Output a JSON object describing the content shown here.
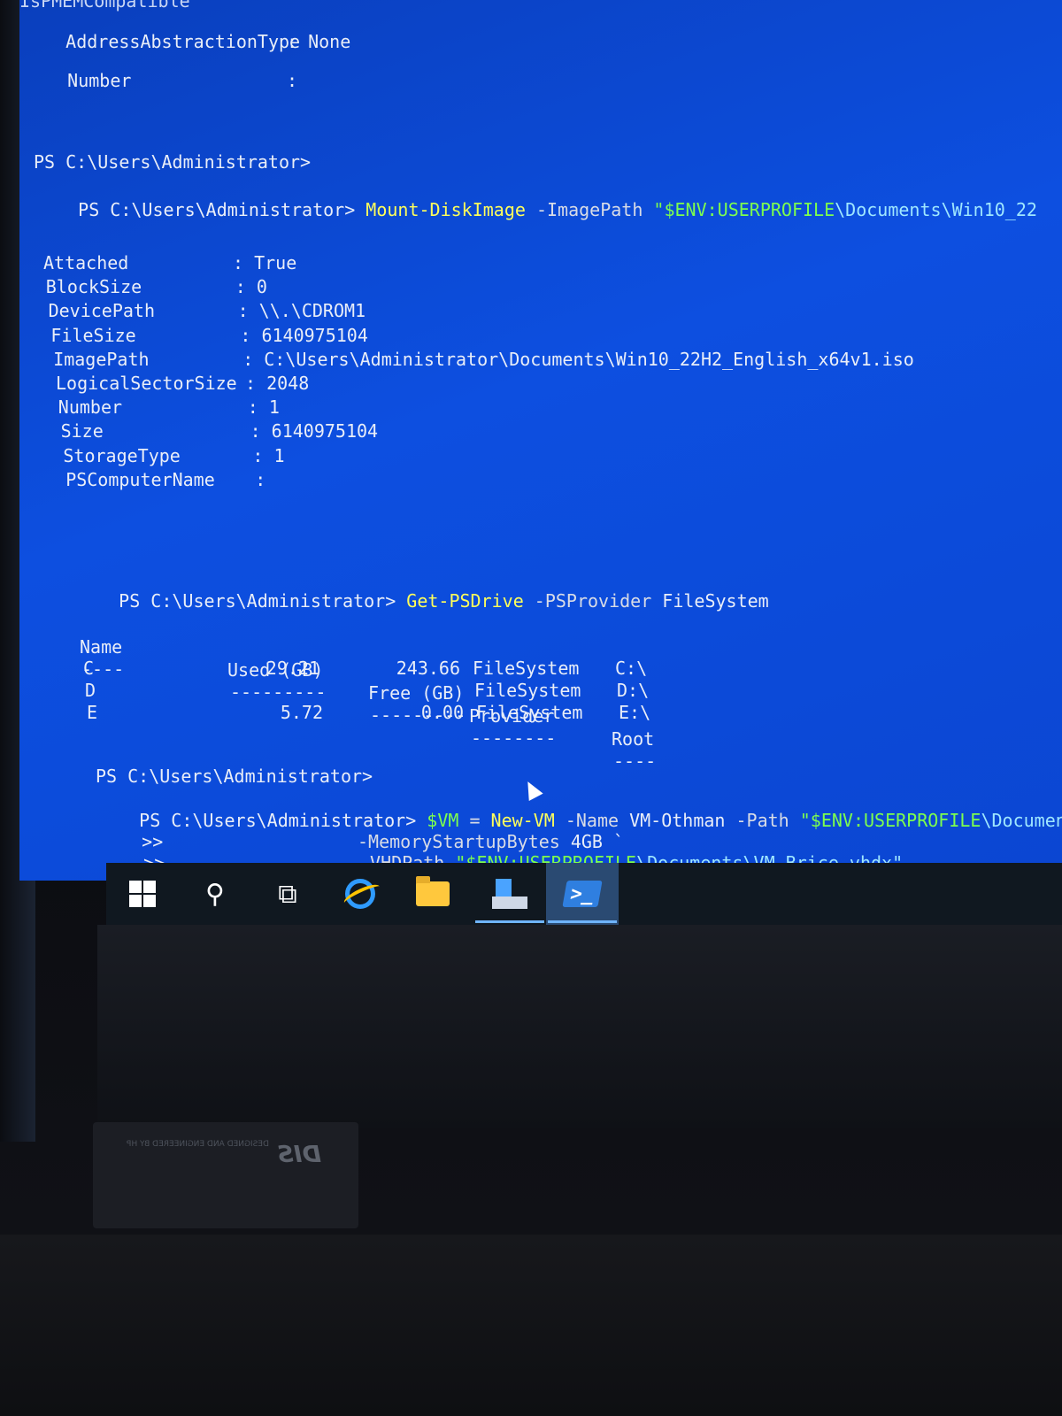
{
  "console": {
    "top_lines": {
      "partial": "IsPMEMCompatible",
      "address_label": "AddressAbstractionType",
      "address_value": ": None",
      "number_label": "Number",
      "number_value": ":"
    },
    "prompt": "PS C:\\Users\\Administrator>",
    "mount_cmd": {
      "cmdlet": "Mount-DiskImage",
      "param": " -ImagePath ",
      "string_start": "\"$ENV:USERPROFILE",
      "string_rest": "\\Documents\\Win10_22"
    },
    "disk_props": [
      {
        "label": "Attached",
        "value": ": True"
      },
      {
        "label": "BlockSize",
        "value": ": 0"
      },
      {
        "label": "DevicePath",
        "value": ": \\\\.\\CDROM1"
      },
      {
        "label": "FileSize",
        "value": ": 6140975104"
      },
      {
        "label": "ImagePath",
        "value": ": C:\\Users\\Administrator\\Documents\\Win10_22H2_English_x64v1.iso"
      },
      {
        "label": "LogicalSectorSize",
        "value": ": 2048"
      },
      {
        "label": "Number",
        "value": ": 1"
      },
      {
        "label": "Size",
        "value": ": 6140975104"
      },
      {
        "label": "StorageType",
        "value": ": 1"
      },
      {
        "label": "PSComputerName",
        "value": ":"
      }
    ],
    "psdrive_cmd": {
      "cmdlet": "Get-PSDrive",
      "param": " -PSProvider ",
      "arg": "FileSystem"
    },
    "table": {
      "headers": {
        "name": "Name",
        "used": "Used (GB)",
        "free": "Free (GB)",
        "provider": "Provider",
        "root": "Root"
      },
      "separators": {
        "name": "----",
        "used": "---------",
        "free": "---------",
        "provider": "--------",
        "root": "----"
      },
      "rows": [
        {
          "name": "C",
          "used": "29.21",
          "free": "243.66",
          "provider": "FileSystem",
          "root": "C:\\"
        },
        {
          "name": "D",
          "used": "",
          "free": "",
          "provider": "FileSystem",
          "root": "D:\\"
        },
        {
          "name": "E",
          "used": "5.72",
          "free": "0.00",
          "provider": "FileSystem",
          "root": "E:\\"
        }
      ]
    },
    "newvm": {
      "var": "$VM",
      "eq": " = ",
      "cmdlet": "New-VM",
      "p1": " -Name ",
      "a1": "VM-Othman",
      "p2": " -Path ",
      "s1_start": "\"$ENV:USERPROFILE",
      "s1_rest": "\\Documents\"",
      "tick": " `",
      "cont": ">>",
      "p3": "-MemoryStartupBytes ",
      "a3": "4GB",
      "p4": "-VHDPath ",
      "s2_start": "\"$ENV:USERPROFILE",
      "s2_rest": "\\Documents\\VM-Brice.vhdx\""
    }
  },
  "taskbar": {
    "items": [
      {
        "icon": "windows-start-icon"
      },
      {
        "icon": "search-icon",
        "glyph": "⚲"
      },
      {
        "icon": "task-view-icon",
        "glyph": "⧉"
      },
      {
        "icon": "internet-explorer-icon"
      },
      {
        "icon": "file-explorer-icon"
      },
      {
        "icon": "server-manager-icon"
      },
      {
        "icon": "powershell-icon",
        "glyph": ">_"
      }
    ]
  },
  "device_badge": {
    "logo": "DIS",
    "text": "DESIGNED AND ENGINEERED BY HP"
  },
  "colors": {
    "console_bg": "#0b46d2",
    "command": "#ffff5a",
    "string": "#7dff4e",
    "text": "#e9eef8"
  }
}
